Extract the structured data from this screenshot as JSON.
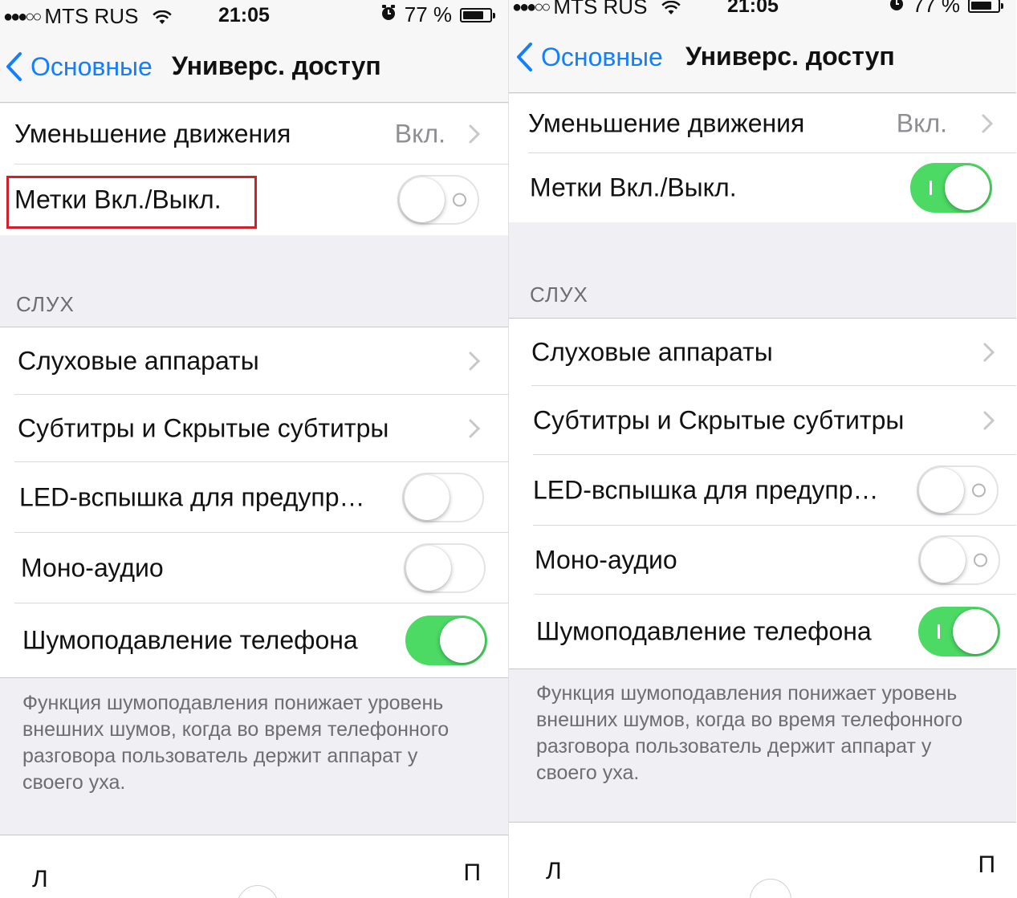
{
  "screens": [
    {
      "status": {
        "carrier": "MTS RUS",
        "time": "21:05",
        "battery": "77 %",
        "battery_level": 0.77
      },
      "nav": {
        "back_label": "Основные",
        "title": "Универс. доступ"
      },
      "rows": {
        "reduce_motion": {
          "label": "Уменьшение движения",
          "value": "Вкл."
        },
        "onoff_labels": {
          "label": "Метки Вкл./Выкл.",
          "on": false
        },
        "hearing_header": "СЛУХ",
        "hearing_aids": {
          "label": "Слуховые аппараты"
        },
        "subtitles": {
          "label": "Субтитры и Скрытые субтитры"
        },
        "led_flash": {
          "label": "LED-вспышка для предупр…",
          "on": false
        },
        "mono_audio": {
          "label": "Моно-аудио",
          "on": false
        },
        "noise_cancel": {
          "label": "Шумоподавление телефона",
          "on": true
        }
      },
      "footer": "Функция шумоподавления понижает уровень внешних шумов, когда во время телефонного разговора пользователь держит аппарат у своего уха.",
      "bottom": {
        "left": "Л",
        "right": "П"
      }
    },
    {
      "status": {
        "carrier": "MTS RUS",
        "time": "21:05",
        "battery": "77 %",
        "battery_level": 0.77
      },
      "nav": {
        "back_label": "Основные",
        "title": "Универс. доступ"
      },
      "rows": {
        "reduce_motion": {
          "label": "Уменьшение движения",
          "value": "Вкл."
        },
        "onoff_labels": {
          "label": "Метки Вкл./Выкл.",
          "on": true
        },
        "hearing_header": "СЛУХ",
        "hearing_aids": {
          "label": "Слуховые аппараты"
        },
        "subtitles": {
          "label": "Субтитры и Скрытые субтитры"
        },
        "led_flash": {
          "label": "LED-вспышка для предупр…",
          "on": false
        },
        "mono_audio": {
          "label": "Моно-аудио",
          "on": false
        },
        "noise_cancel": {
          "label": "Шумоподавление телефона",
          "on": true
        }
      },
      "footer": "Функция шумоподавления понижает уровень внешних шумов, когда во время телефонного разговора пользователь держит аппарат у своего уха.",
      "bottom": {
        "left": "Л",
        "right": "П"
      }
    }
  ],
  "colors": {
    "accent": "#147efb",
    "switch_on": "#4cd964",
    "highlight": "#d0212a",
    "group_bg": "#efeff4"
  }
}
